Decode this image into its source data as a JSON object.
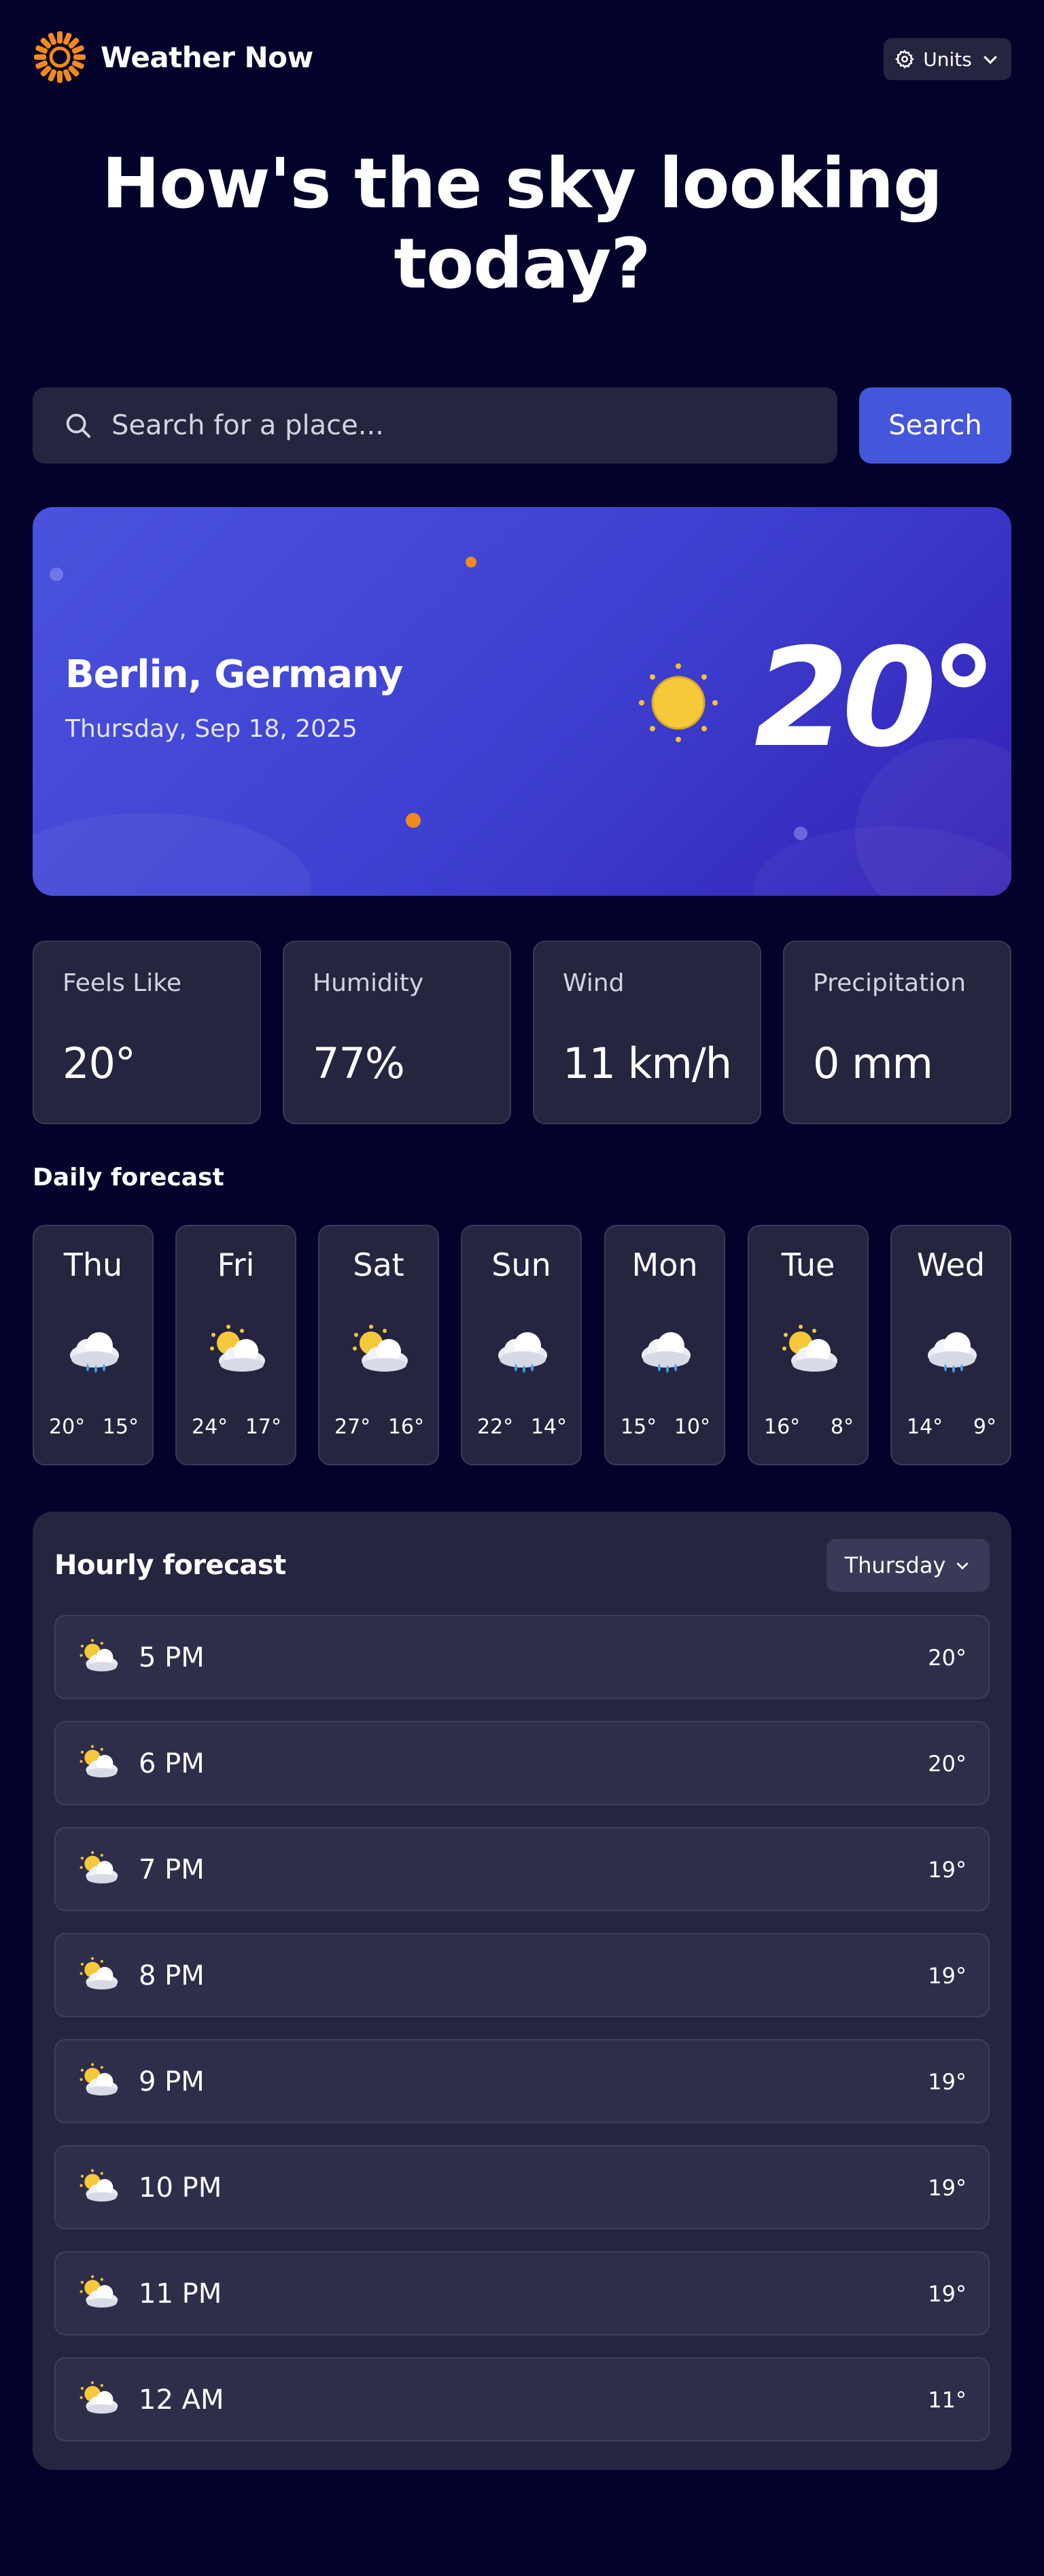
{
  "app": {
    "title": "Weather Now",
    "units_label": "Units"
  },
  "hero": {
    "title": "How's the sky looking\ntoday?"
  },
  "search": {
    "placeholder": "Search for a place...",
    "button_label": "Search"
  },
  "current": {
    "location": "Berlin, Germany",
    "date": "Thursday, Sep 18, 2025",
    "temperature": "20°",
    "icon": "sun-icon"
  },
  "stats": [
    {
      "label": "Feels Like",
      "value": "20°"
    },
    {
      "label": "Humidity",
      "value": "77%"
    },
    {
      "label": "Wind",
      "value": "11 km/h"
    },
    {
      "label": "Precipitation",
      "value": "0 mm"
    }
  ],
  "daily": {
    "title": "Daily forecast",
    "days": [
      {
        "name": "Thu",
        "icon": "rain-icon",
        "high": "20°",
        "low": "15°"
      },
      {
        "name": "Fri",
        "icon": "partly-cloudy-icon",
        "high": "24°",
        "low": "17°"
      },
      {
        "name": "Sat",
        "icon": "partly-cloudy-icon",
        "high": "27°",
        "low": "16°"
      },
      {
        "name": "Sun",
        "icon": "rain-icon",
        "high": "22°",
        "low": "14°"
      },
      {
        "name": "Mon",
        "icon": "rain-icon",
        "high": "15°",
        "low": "10°"
      },
      {
        "name": "Tue",
        "icon": "partly-cloudy-icon",
        "high": "16°",
        "low": "8°"
      },
      {
        "name": "Wed",
        "icon": "rain-icon",
        "high": "14°",
        "low": "9°"
      }
    ]
  },
  "hourly": {
    "title": "Hourly forecast",
    "selected_day": "Thursday",
    "hours": [
      {
        "time": "5 PM",
        "icon": "partly-cloudy-icon",
        "temp": "20°"
      },
      {
        "time": "6 PM",
        "icon": "partly-cloudy-icon",
        "temp": "20°"
      },
      {
        "time": "7 PM",
        "icon": "partly-cloudy-icon",
        "temp": "19°"
      },
      {
        "time": "8 PM",
        "icon": "partly-cloudy-icon",
        "temp": "19°"
      },
      {
        "time": "9 PM",
        "icon": "partly-cloudy-icon",
        "temp": "19°"
      },
      {
        "time": "10 PM",
        "icon": "partly-cloudy-icon",
        "temp": "19°"
      },
      {
        "time": "11 PM",
        "icon": "partly-cloudy-icon",
        "temp": "19°"
      },
      {
        "time": "12 AM",
        "icon": "partly-cloudy-icon",
        "temp": "11°"
      }
    ]
  },
  "colors": {
    "background": "#03022a",
    "panel": "#262540",
    "accent": "#4456d9",
    "logo": "#f08a1c"
  }
}
